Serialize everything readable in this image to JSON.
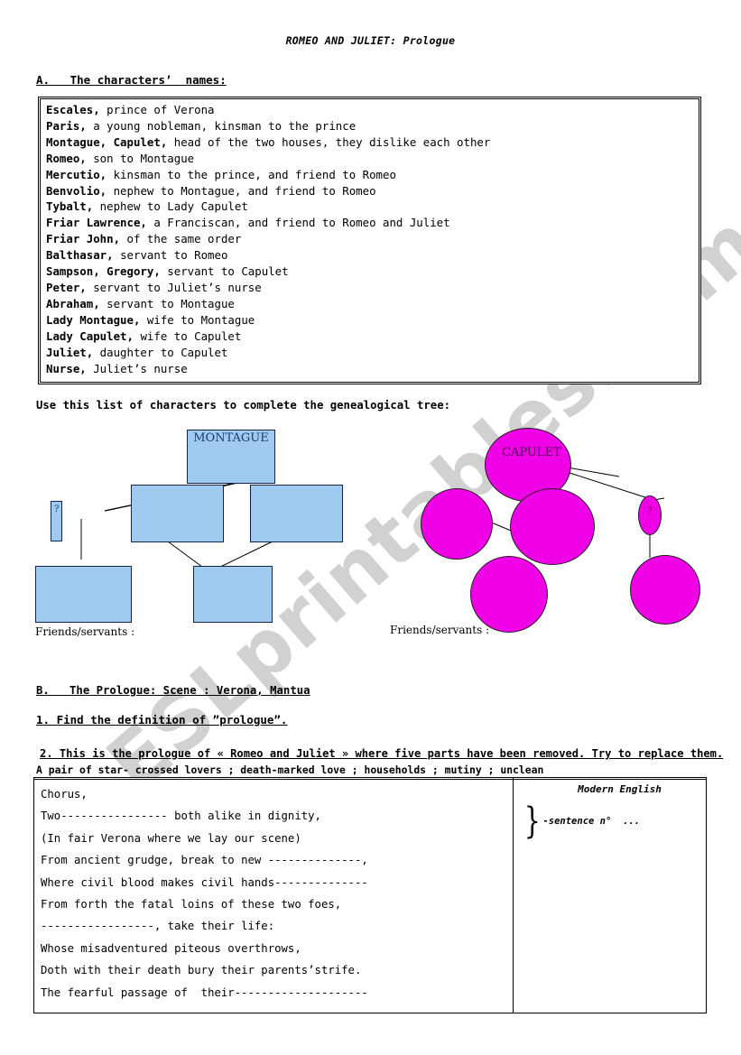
{
  "document": {
    "title": "ROMEO AND JULIET: Prologue"
  },
  "section_a": {
    "heading": "A.   The characters’  names:",
    "characters": [
      {
        "name": "Escales,",
        "description": " prince of Verona"
      },
      {
        "name": "Paris,",
        "description": " a young nobleman, kinsman to the prince"
      },
      {
        "name": "Montague, Capulet,",
        "description": " head of the two houses, they dislike each other"
      },
      {
        "name": "Romeo,",
        "description": " son to Montague"
      },
      {
        "name": "Mercutio,",
        "description": " kinsman to the prince, and friend to Romeo"
      },
      {
        "name": "Benvolio,",
        "description": " nephew to Montague, and friend to Romeo"
      },
      {
        "name": "Tybalt,",
        "description": " nephew to Lady Capulet"
      },
      {
        "name": "Friar Lawrence,",
        "description": " a Franciscan, and friend to Romeo and Juliet"
      },
      {
        "name": "Friar John,",
        "description": " of the same order"
      },
      {
        "name": "Balthasar,",
        "description": " servant to Romeo"
      },
      {
        "name": "Sampson, Gregory,",
        "description": " servant to Capulet"
      },
      {
        "name": "Peter,",
        "description": " servant to Juliet’s nurse"
      },
      {
        "name": "Abraham,",
        "description": " servant to Montague"
      },
      {
        "name": "Lady Montague,",
        "description": " wife to Montague"
      },
      {
        "name": "Lady Capulet,",
        "description": " wife to Capulet"
      },
      {
        "name": "Juliet,",
        "description": " daughter to Capulet"
      },
      {
        "name": "Nurse,",
        "description": " Juliet’s nurse"
      }
    ]
  },
  "tree": {
    "instruction": "Use this list of characters to complete the genealogical tree:",
    "montague_root_label": "MONTAGUE",
    "capulet_root_label": "CAPULET",
    "unknown_label": "?",
    "friends_servants_left": "Friends/servants :",
    "friends_servants_right": "Friends/servants :",
    "colors": {
      "box_fill": "#9ecbef",
      "box_border": "#12264a",
      "box_text": "#1f3a6e",
      "circle_fill": "#ef00e7",
      "circle_border": "#202020",
      "circle_text": "#4b0b4b"
    }
  },
  "section_b": {
    "heading": "B.   The Prologue: Scene : Verona, Mantua",
    "question_1": "1. Find the definition of ”prologue”.",
    "question_2": "2. This is the prologue of « Romeo and Juliet » where five parts have been removed. Try to replace them.",
    "word_bank": "A pair of star- crossed lovers ; death-marked love ; households ; mutiny ; unclean",
    "prologue_lines": [
      "Chorus,",
      "Two---------------- both alike in dignity,",
      "(In fair Verona where we lay our scene)",
      "From ancient grudge, break to new --------------,",
      "Where civil blood makes civil hands--------------",
      "From forth the fatal loins of these two foes,",
      "-----------------, take their life:",
      "Whose misadventured piteous overthrows,",
      "Doth with their death bury their parents’strife.",
      "The fearful passage of  their--------------------"
    ],
    "modern_english_title": "Modern English",
    "modern_english_note": "-sentence n°  ..."
  },
  "watermark": {
    "text": "ESLprintables.com"
  }
}
